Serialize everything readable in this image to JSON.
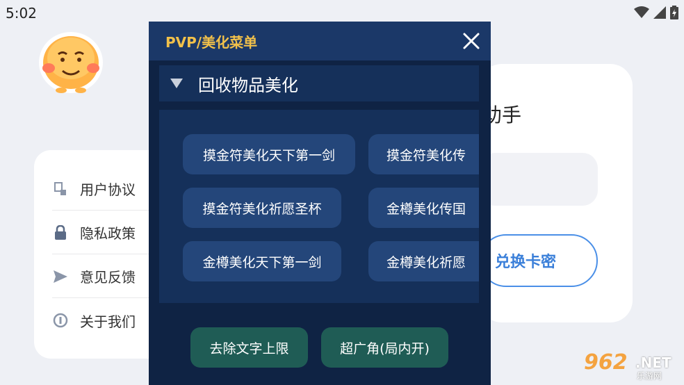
{
  "status_bar": {
    "time": "5:02"
  },
  "menu": {
    "items": [
      {
        "label": "用户协议",
        "icon": "document-icon"
      },
      {
        "label": "隐私政策",
        "icon": "lock-icon"
      },
      {
        "label": "意见反馈",
        "icon": "send-icon"
      },
      {
        "label": "关于我们",
        "icon": "info-icon"
      }
    ]
  },
  "right_card": {
    "title_partial": "助手",
    "redeem_label": "兑换卡密"
  },
  "overlay": {
    "title": "PVP/美化菜单",
    "section_label": "回收物品美化",
    "chips": [
      "摸金符美化天下第一剑",
      "摸金符美化传",
      "摸金符美化祈愿圣杯",
      "金樽美化传国",
      "金樽美化天下第一剑",
      "金樽美化祈愿"
    ],
    "actions": [
      "去除文字上限",
      "超广角(局内开)"
    ]
  },
  "watermark": {
    "num": "962",
    "net": ".NET",
    "cn": "乐游网"
  },
  "colors": {
    "overlay_bg": "#0f2344",
    "header_bg": "#1b3868",
    "title_gold": "#f2c14a",
    "chip_bg": "#24467a",
    "action_bg": "#1f5c55",
    "accent_blue": "#3a7fd9"
  }
}
